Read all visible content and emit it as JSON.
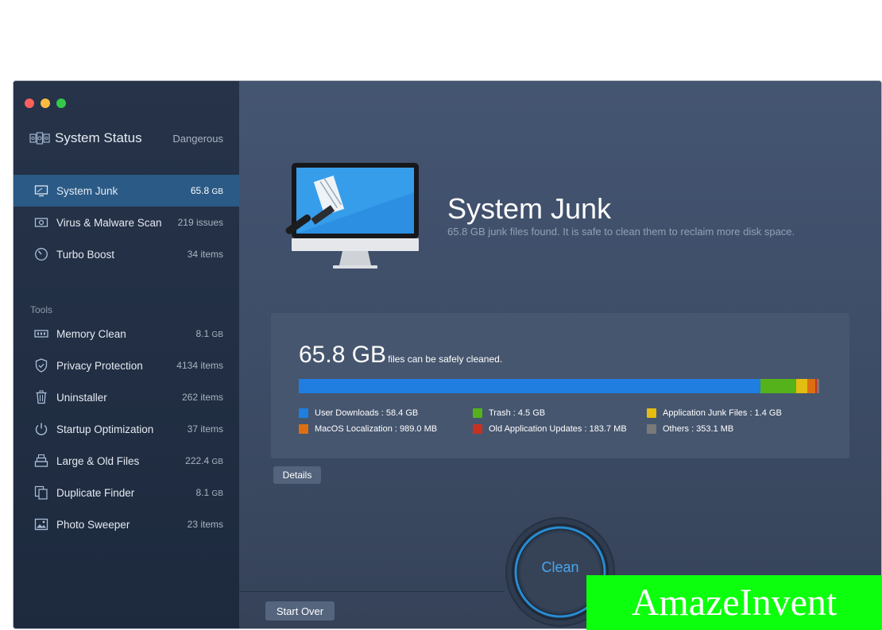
{
  "header": {
    "title": "System Status",
    "status": "Dangerous"
  },
  "nav": {
    "scan_items": [
      {
        "label": "System Junk",
        "count": "65.8",
        "unit": "GB",
        "icon": "monitor-icon",
        "active": true
      },
      {
        "label": "Virus & Malware Scan",
        "count": "219 issues",
        "icon": "virus-scan-icon"
      },
      {
        "label": "Turbo Boost",
        "count": "34 items",
        "icon": "speedometer-icon"
      }
    ],
    "tools_heading": "Tools",
    "tool_items": [
      {
        "label": "Memory Clean",
        "count": "8.1",
        "unit": "GB",
        "icon": "memory-chip-icon"
      },
      {
        "label": "Privacy Protection",
        "count": "4134 items",
        "icon": "shield-icon"
      },
      {
        "label": "Uninstaller",
        "count": "262 items",
        "icon": "trash-icon"
      },
      {
        "label": "Startup Optimization",
        "count": "37 items",
        "icon": "power-icon"
      },
      {
        "label": "Large & Old Files",
        "count": "222.4",
        "unit": "GB",
        "icon": "file-stack-icon"
      },
      {
        "label": "Duplicate Finder",
        "count": "8.1",
        "unit": "GB",
        "icon": "duplicate-icon"
      },
      {
        "label": "Photo Sweeper",
        "count": "23 items",
        "icon": "photo-icon"
      }
    ]
  },
  "main": {
    "title": "System Junk",
    "subtitle": "65.8 GB junk files found.  It is safe to clean them to reclaim more disk space.",
    "summary_amount": "65.8 GB",
    "summary_suffix": "files can be safely cleaned.",
    "total_gb": 65.8,
    "breakdown": [
      {
        "label": "User Downloads : 58.4 GB",
        "gb": 58.4,
        "color": "#1f7ee0"
      },
      {
        "label": "Trash : 4.5 GB",
        "gb": 4.5,
        "color": "#55b21b"
      },
      {
        "label": "Application Junk Files : 1.4 GB",
        "gb": 1.4,
        "color": "#e3bd0f"
      },
      {
        "label": "MacOS Localization : 989.0 MB",
        "gb": 0.989,
        "color": "#dd6f12"
      },
      {
        "label": "Old Application Updates : 183.7 MB",
        "gb": 0.1837,
        "color": "#c83120"
      },
      {
        "label": "Others : 353.1 MB",
        "gb": 0.3531,
        "color": "#7a7a7a"
      }
    ],
    "details_button": "Details",
    "clean_button": "Clean",
    "start_over_button": "Start Over"
  },
  "watermark": "AmazeInvent"
}
